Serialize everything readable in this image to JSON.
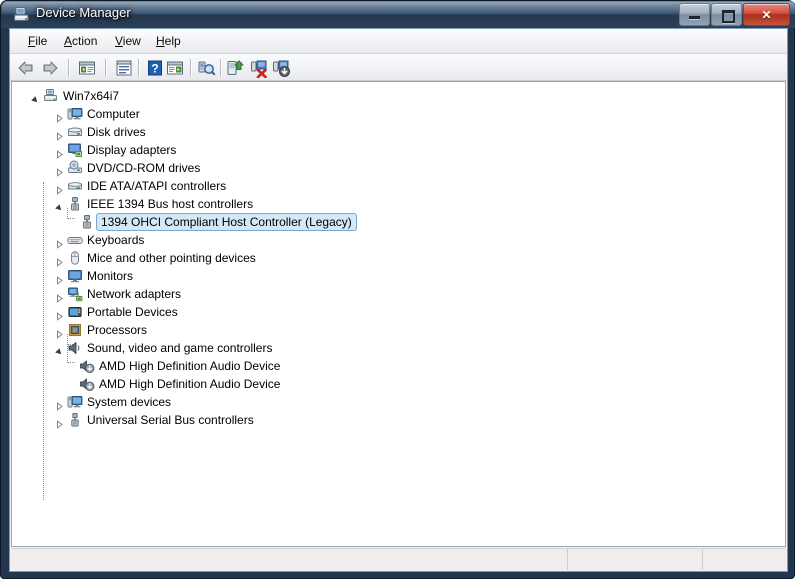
{
  "window": {
    "title": "Device Manager",
    "icon": "device-manager-icon",
    "buttons": {
      "minimize": "–",
      "maximize": "□",
      "close": "✕"
    }
  },
  "menu": {
    "items": [
      {
        "label": "File",
        "accel": "F"
      },
      {
        "label": "Action",
        "accel": "A"
      },
      {
        "label": "View",
        "accel": "V"
      },
      {
        "label": "Help",
        "accel": "H"
      }
    ]
  },
  "toolbar": {
    "buttons": [
      {
        "name": "back-button",
        "tooltip": "Back"
      },
      {
        "name": "forward-button",
        "tooltip": "Forward"
      },
      {
        "name": "show-hide-console-tree-button",
        "tooltip": "Show/Hide Console Tree"
      },
      {
        "name": "properties-button",
        "tooltip": "Properties"
      },
      {
        "name": "help-button",
        "tooltip": "Help"
      },
      {
        "name": "show-hide-action-pane-button",
        "tooltip": "Show/Hide Action Pane"
      },
      {
        "name": "scan-for-hardware-changes-button",
        "tooltip": "Scan for hardware changes"
      },
      {
        "name": "update-driver-button",
        "tooltip": "Update Driver Software"
      },
      {
        "name": "uninstall-device-button",
        "tooltip": "Uninstall"
      },
      {
        "name": "disable-device-button",
        "tooltip": "Disable"
      }
    ]
  },
  "tree": {
    "nodes": [
      {
        "label": "Win7x64i7",
        "depth": 0,
        "state": "expanded",
        "icon": "computer-root-icon",
        "selected": false
      },
      {
        "label": "Computer",
        "depth": 1,
        "state": "collapsed",
        "icon": "computer-icon",
        "selected": false
      },
      {
        "label": "Disk drives",
        "depth": 1,
        "state": "collapsed",
        "icon": "disk-drive-icon",
        "selected": false
      },
      {
        "label": "Display adapters",
        "depth": 1,
        "state": "collapsed",
        "icon": "display-adapter-icon",
        "selected": false
      },
      {
        "label": "DVD/CD-ROM drives",
        "depth": 1,
        "state": "collapsed",
        "icon": "dvd-drive-icon",
        "selected": false
      },
      {
        "label": "IDE ATA/ATAPI controllers",
        "depth": 1,
        "state": "collapsed",
        "icon": "ide-controller-icon",
        "selected": false
      },
      {
        "label": "IEEE 1394 Bus host controllers",
        "depth": 1,
        "state": "expanded",
        "icon": "ieee1394-icon",
        "selected": false
      },
      {
        "label": "1394 OHCI Compliant Host Controller (Legacy)",
        "depth": 2,
        "state": "leaf",
        "icon": "ieee1394-icon",
        "selected": true
      },
      {
        "label": "Keyboards",
        "depth": 1,
        "state": "collapsed",
        "icon": "keyboard-icon",
        "selected": false
      },
      {
        "label": "Mice and other pointing devices",
        "depth": 1,
        "state": "collapsed",
        "icon": "mouse-icon",
        "selected": false
      },
      {
        "label": "Monitors",
        "depth": 1,
        "state": "collapsed",
        "icon": "monitor-icon",
        "selected": false
      },
      {
        "label": "Network adapters",
        "depth": 1,
        "state": "collapsed",
        "icon": "network-adapter-icon",
        "selected": false
      },
      {
        "label": "Portable Devices",
        "depth": 1,
        "state": "collapsed",
        "icon": "portable-device-icon",
        "selected": false
      },
      {
        "label": "Processors",
        "depth": 1,
        "state": "collapsed",
        "icon": "processor-icon",
        "selected": false
      },
      {
        "label": "Sound, video and game controllers",
        "depth": 1,
        "state": "expanded",
        "icon": "sound-icon",
        "selected": false
      },
      {
        "label": "AMD High Definition Audio Device",
        "depth": 2,
        "state": "leaf",
        "icon": "audio-device-icon",
        "selected": false
      },
      {
        "label": "AMD High Definition Audio Device",
        "depth": 2,
        "state": "leaf",
        "icon": "audio-device-icon",
        "selected": false
      },
      {
        "label": "System devices",
        "depth": 1,
        "state": "collapsed",
        "icon": "system-device-icon",
        "selected": false
      },
      {
        "label": "Universal Serial Bus controllers",
        "depth": 1,
        "state": "collapsed",
        "icon": "usb-icon",
        "selected": false
      }
    ]
  },
  "statusbar": {
    "panes": [
      "",
      "",
      ""
    ]
  },
  "colors": {
    "selection_fill": "#d4e9f8",
    "selection_border": "#7aa6c9",
    "titlebar": "#2c4158",
    "close_button": "#ab2f1e",
    "content_bg": "#ffffff"
  }
}
